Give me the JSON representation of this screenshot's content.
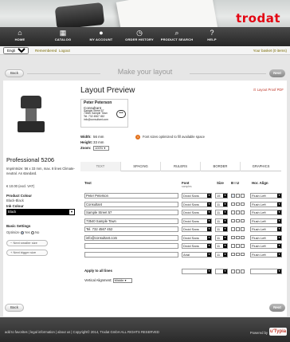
{
  "brand": {
    "logo": "trodat",
    "color": "#e30613"
  },
  "nav": [
    {
      "label": "HOME",
      "icon": "home-icon",
      "glyph": "⌂"
    },
    {
      "label": "CATALOG",
      "icon": "catalog-icon",
      "glyph": "▦"
    },
    {
      "label": "MY ACCOUNT",
      "icon": "user-icon",
      "glyph": "👤"
    },
    {
      "label": "ORDER HISTORY",
      "icon": "clock-icon",
      "glyph": "◷"
    },
    {
      "label": "PRODUCT SEARCH",
      "icon": "search-icon",
      "glyph": "⌕"
    },
    {
      "label": "HELP",
      "icon": "help-icon",
      "glyph": "?"
    }
  ],
  "subbar": {
    "language": "English (UK)",
    "link1": "Remembered",
    "link2": "Logout",
    "basket": "Your basket (0 items)"
  },
  "step": {
    "back": "Back",
    "next": "Next",
    "title": "Make your layout"
  },
  "product": {
    "name": "Professional 5206",
    "desc": "Imprintsize: 56 x 33 mm, max. 8 lines Climate-neutral. As standard.",
    "price": "€ 10.00 (excl. VAT)",
    "colour_label": "Product Colour",
    "colour_value": "Black-Black",
    "ink_label": "Ink Colour",
    "ink_value": "Black",
    "basic_settings": "Basic Settings",
    "optimize": "Optimize",
    "yes": "Yes",
    "no": "No",
    "smaller": "Next smaller size",
    "bigger": "Next bigger size"
  },
  "preview": {
    "title": "Layout Preview",
    "pdf": "Layout Proof PDF",
    "lines": [
      "Peter Peterson",
      "Consultant",
      "Sample Street 57",
      "73540 Sample Town",
      "Tel. 732 4567 452",
      "info@consultant.com"
    ],
    "width_label": "Width:",
    "width_value": "56 mm",
    "height_label": "Height:",
    "height_value": "33 mm",
    "zoom_label": "Zoom:",
    "zoom_value": "100%",
    "note": "Font sizes optimized to fill available space"
  },
  "tabs": [
    "TEXT",
    "SPACING",
    "RULERS",
    "BORDER",
    "GRAPHICS"
  ],
  "table": {
    "col_text": "Text",
    "col_font": "Font",
    "col_font_sub": "samples",
    "col_size": "Size",
    "col_bi": "B  I  U",
    "col_align": "Hor. Align",
    "rows": [
      {
        "text": "Peter Peterson",
        "font": "Droid Sans",
        "size": "15",
        "b": true,
        "align": "Flush Left"
      },
      {
        "text": "Consultant",
        "font": "Droid Sans",
        "size": "11",
        "b": false,
        "align": "Flush Left"
      },
      {
        "text": "Sample Street 57",
        "font": "Droid Sans",
        "size": "11",
        "b": false,
        "align": "Flush Left"
      },
      {
        "text": "73540 Sample Town",
        "font": "Droid Sans",
        "size": "11",
        "b": false,
        "align": "Flush Left"
      },
      {
        "text": "Tel. 732 4567 452",
        "font": "Droid Sans",
        "size": "11",
        "b": false,
        "align": "Flush Left"
      },
      {
        "text": "info@consultant.com",
        "font": "Droid Sans",
        "size": "11",
        "b": false,
        "align": "Flush Left"
      },
      {
        "text": "",
        "font": "Droid Sans",
        "size": "11",
        "b": false,
        "align": "Flush Left"
      },
      {
        "text": "",
        "font": "Arial",
        "size": "11",
        "b": false,
        "align": "Flush Left"
      }
    ],
    "apply_all": "Apply to all lines",
    "valign_label": "Vertical Alignment:",
    "valign_value": "Middle"
  },
  "footer": {
    "links": "add to favorites  |  legal information  |  about us  |  Copyright© 2014, Trodat GmbH ALL RIGHTS RESERVED",
    "powered": "Powered by",
    "brand": "u'Typia"
  }
}
